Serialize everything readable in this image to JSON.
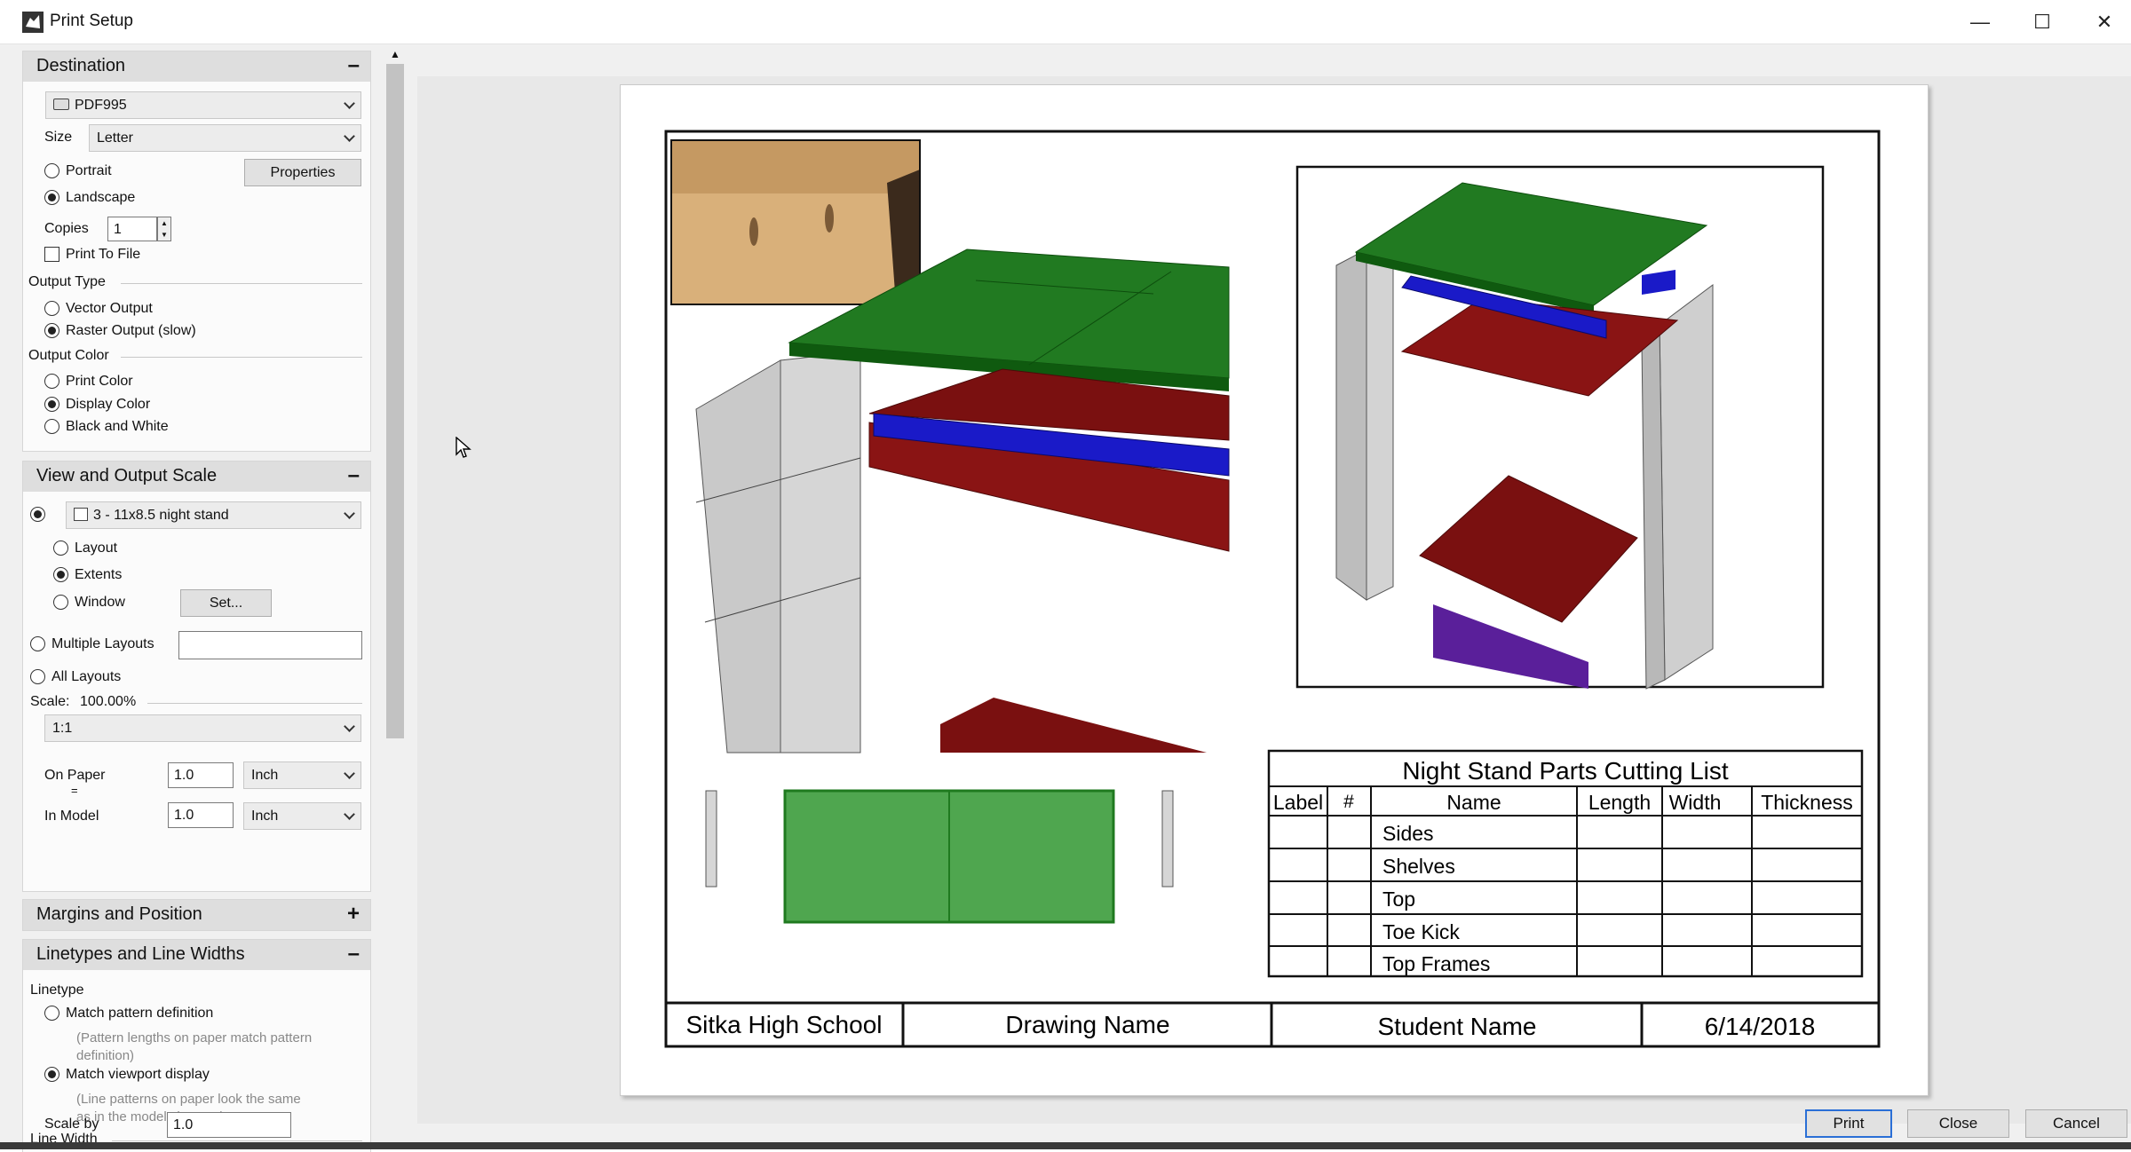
{
  "window": {
    "title": "Print Setup",
    "minimize": "—",
    "maximize": "☐",
    "close": "✕"
  },
  "destination": {
    "header": "Destination",
    "collapse": "–",
    "printer": "PDF995",
    "size_label": "Size",
    "size_value": "Letter",
    "portrait": "Portrait",
    "landscape": "Landscape",
    "orientation_selected": "Landscape",
    "properties_button": "Properties",
    "copies_label": "Copies",
    "copies_value": "1",
    "print_to_file": "Print To File",
    "print_to_file_checked": false,
    "output_type_label": "Output Type",
    "vector_output": "Vector Output",
    "raster_output": "Raster Output (slow)",
    "output_type_selected": "Raster Output (slow)",
    "output_color_label": "Output Color",
    "print_color": "Print Color",
    "display_color": "Display Color",
    "black_white": "Black and White",
    "output_color_selected": "Display Color"
  },
  "view_scale": {
    "header": "View and Output Scale",
    "collapse": "–",
    "view_selected": "3 - 11x8.5 night stand",
    "layout": "Layout",
    "extents": "Extents",
    "window": "Window",
    "area_selected": "Extents",
    "set_button": "Set...",
    "multiple_layouts": "Multiple Layouts",
    "multiple_layouts_value": "",
    "all_layouts": "All Layouts",
    "scale_label": "Scale:",
    "scale_value": "100.00%",
    "ratio": "1:1",
    "on_paper_label": "On Paper",
    "on_paper_value": "1.0",
    "on_paper_unit": "Inch",
    "equals": "=",
    "in_model_label": "In Model",
    "in_model_value": "1.0",
    "in_model_unit": "Inch"
  },
  "margins": {
    "header": "Margins and Position",
    "expand": "+"
  },
  "linetypes": {
    "header": "Linetypes and Line Widths",
    "collapse": "–",
    "linetype_label": "Linetype",
    "match_pattern": "Match pattern definition",
    "match_pattern_hint_1": "(Pattern lengths on paper match pattern",
    "match_pattern_hint_2": "definition)",
    "match_viewport": "Match viewport display",
    "match_viewport_hint_1": "(Line patterns on paper look the same",
    "match_viewport_hint_2": "as in the model viewport)",
    "linetype_selected": "Match viewport display",
    "line_width_label": "Line Width",
    "scale_by_label": "Scale by",
    "scale_by_value": "1.0"
  },
  "drawing": {
    "table_title": "Night Stand Parts Cutting List",
    "columns": [
      "Label",
      "#",
      "Name",
      "Length",
      "Width",
      "Thickness"
    ],
    "rows": [
      "Sides",
      "Shelves",
      "Top",
      "Toe Kick",
      "Top Frames"
    ],
    "school": "Sitka High School",
    "drawing_name": "Drawing Name",
    "student_name": "Student Name",
    "date": "6/14/2018",
    "colors": {
      "top": "#1f7a1f",
      "shelf": "#7a1010",
      "rail": "#1a1ac8",
      "kick": "#5a1f9a",
      "side": "#cfcfcf"
    }
  },
  "buttons": {
    "print": "Print",
    "close": "Close",
    "cancel": "Cancel"
  }
}
